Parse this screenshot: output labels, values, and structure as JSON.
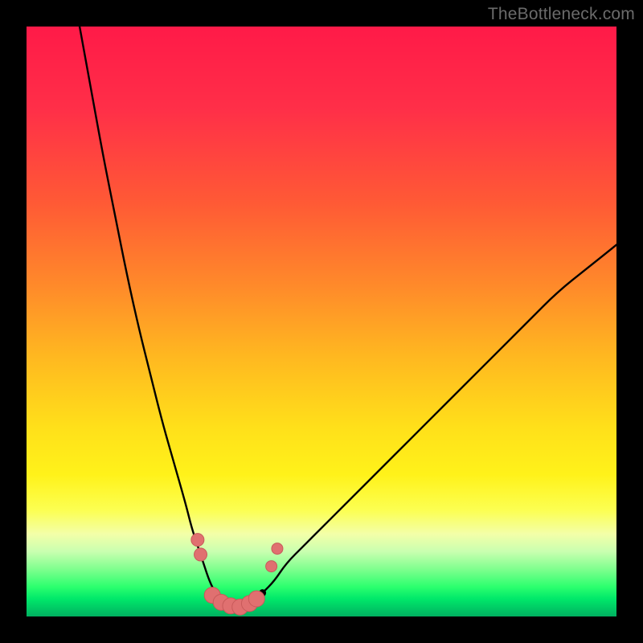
{
  "watermark": {
    "text": "TheBottleneck.com"
  },
  "colors": {
    "frame_bg": "#000000",
    "curve_stroke": "#000000",
    "marker_fill": "#e07070",
    "marker_stroke": "#c85a5a",
    "gradient_stops": [
      "#ff1a48",
      "#ff5a35",
      "#ffb820",
      "#fff21a",
      "#c9ffb0",
      "#2bff6e",
      "#00b060"
    ]
  },
  "chart_data": {
    "type": "line",
    "title": "",
    "xlabel": "",
    "ylabel": "",
    "xlim": [
      0,
      100
    ],
    "ylim": [
      0,
      100
    ],
    "grid": false,
    "legend": false,
    "series": [
      {
        "name": "left-branch",
        "x": [
          9,
          11,
          13,
          15,
          17,
          19,
          21,
          23,
          25,
          27,
          28,
          29,
          30,
          31,
          32
        ],
        "y": [
          100,
          89,
          78,
          68,
          58,
          49,
          41,
          33,
          26,
          19,
          15,
          12,
          9,
          6,
          4
        ]
      },
      {
        "name": "right-branch",
        "x": [
          40,
          42,
          44,
          47,
          50,
          55,
          60,
          65,
          70,
          75,
          80,
          85,
          90,
          95,
          100
        ],
        "y": [
          4,
          6,
          9,
          12,
          15,
          20,
          25,
          30,
          35,
          40,
          45,
          50,
          55,
          59,
          63
        ]
      },
      {
        "name": "valley-floor",
        "x": [
          32,
          33,
          34,
          35,
          36,
          37,
          38,
          39,
          40
        ],
        "y": [
          4,
          2.5,
          1.6,
          1.2,
          1.1,
          1.3,
          1.8,
          2.6,
          4
        ]
      }
    ],
    "markers": [
      {
        "name": "left-cluster-upper",
        "x": 29.0,
        "y": 13.0,
        "r": 8
      },
      {
        "name": "left-cluster-lower",
        "x": 29.5,
        "y": 10.5,
        "r": 8
      },
      {
        "name": "floor-a",
        "x": 31.5,
        "y": 3.6,
        "r": 10
      },
      {
        "name": "floor-b",
        "x": 33.0,
        "y": 2.4,
        "r": 10
      },
      {
        "name": "floor-c",
        "x": 34.6,
        "y": 1.8,
        "r": 10
      },
      {
        "name": "floor-d-min",
        "x": 36.2,
        "y": 1.6,
        "r": 10
      },
      {
        "name": "floor-e",
        "x": 37.8,
        "y": 2.2,
        "r": 10
      },
      {
        "name": "floor-f",
        "x": 39.0,
        "y": 3.0,
        "r": 10
      },
      {
        "name": "right-cluster-lower",
        "x": 41.5,
        "y": 8.5,
        "r": 7
      },
      {
        "name": "right-cluster-upper",
        "x": 42.5,
        "y": 11.5,
        "r": 7
      }
    ]
  }
}
